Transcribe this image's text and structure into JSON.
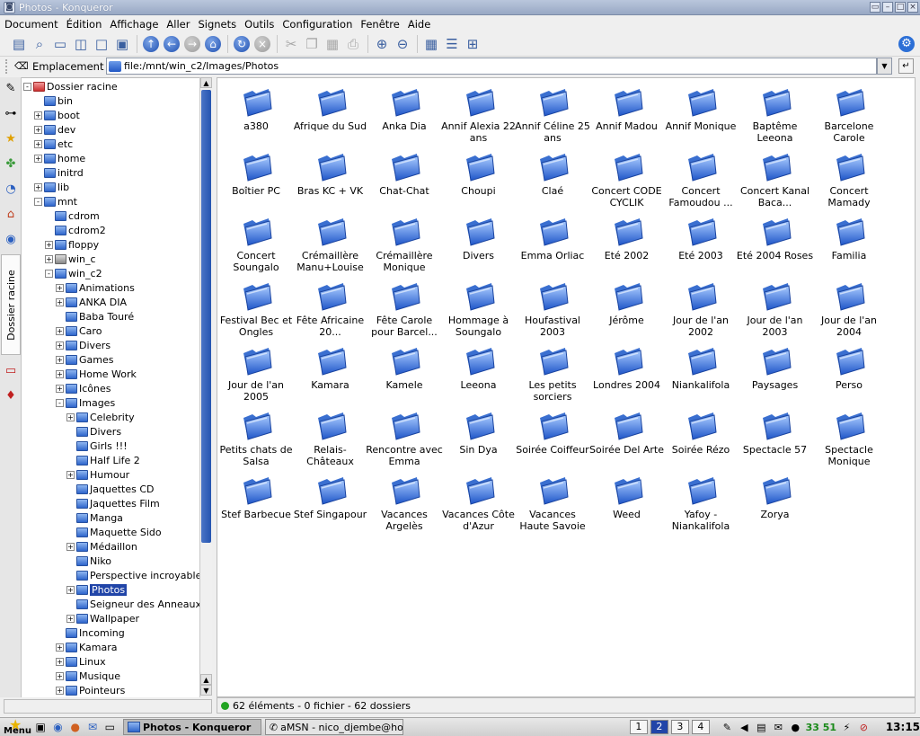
{
  "window": {
    "title": "Photos - Konqueror"
  },
  "menubar": [
    "Document",
    "Édition",
    "Affichage",
    "Aller",
    "Signets",
    "Outils",
    "Configuration",
    "Fenêtre",
    "Aide"
  ],
  "location": {
    "label": "Emplacement :",
    "value": "file:/mnt/win_c2/Images/Photos"
  },
  "sidebar_tab_label": "Dossier racine",
  "tree": [
    {
      "label": "Dossier racine",
      "depth": 0,
      "exp": "-",
      "icon": "red"
    },
    {
      "label": "bin",
      "depth": 1,
      "exp": "",
      "icon": "folder"
    },
    {
      "label": "boot",
      "depth": 1,
      "exp": "+",
      "icon": "folder"
    },
    {
      "label": "dev",
      "depth": 1,
      "exp": "+",
      "icon": "folder"
    },
    {
      "label": "etc",
      "depth": 1,
      "exp": "+",
      "icon": "folder"
    },
    {
      "label": "home",
      "depth": 1,
      "exp": "+",
      "icon": "folder"
    },
    {
      "label": "initrd",
      "depth": 1,
      "exp": "",
      "icon": "folder"
    },
    {
      "label": "lib",
      "depth": 1,
      "exp": "+",
      "icon": "folder"
    },
    {
      "label": "mnt",
      "depth": 1,
      "exp": "-",
      "icon": "folder"
    },
    {
      "label": "cdrom",
      "depth": 2,
      "exp": "",
      "icon": "folder"
    },
    {
      "label": "cdrom2",
      "depth": 2,
      "exp": "",
      "icon": "folder"
    },
    {
      "label": "floppy",
      "depth": 2,
      "exp": "+",
      "icon": "folder"
    },
    {
      "label": "win_c",
      "depth": 2,
      "exp": "+",
      "icon": "drive"
    },
    {
      "label": "win_c2",
      "depth": 2,
      "exp": "-",
      "icon": "folder"
    },
    {
      "label": "Animations",
      "depth": 3,
      "exp": "+",
      "icon": "folder"
    },
    {
      "label": "ANKA DIA",
      "depth": 3,
      "exp": "+",
      "icon": "folder"
    },
    {
      "label": "Baba Touré",
      "depth": 3,
      "exp": "",
      "icon": "folder"
    },
    {
      "label": "Caro",
      "depth": 3,
      "exp": "+",
      "icon": "folder"
    },
    {
      "label": "Divers",
      "depth": 3,
      "exp": "+",
      "icon": "folder"
    },
    {
      "label": "Games",
      "depth": 3,
      "exp": "+",
      "icon": "folder"
    },
    {
      "label": "Home Work",
      "depth": 3,
      "exp": "+",
      "icon": "folder"
    },
    {
      "label": "Icônes",
      "depth": 3,
      "exp": "+",
      "icon": "folder"
    },
    {
      "label": "Images",
      "depth": 3,
      "exp": "-",
      "icon": "folder"
    },
    {
      "label": "Celebrity",
      "depth": 4,
      "exp": "+",
      "icon": "folder"
    },
    {
      "label": "Divers",
      "depth": 4,
      "exp": "",
      "icon": "folder"
    },
    {
      "label": "Girls !!!",
      "depth": 4,
      "exp": "",
      "icon": "folder"
    },
    {
      "label": "Half Life 2",
      "depth": 4,
      "exp": "",
      "icon": "folder"
    },
    {
      "label": "Humour",
      "depth": 4,
      "exp": "+",
      "icon": "folder"
    },
    {
      "label": "Jaquettes CD",
      "depth": 4,
      "exp": "",
      "icon": "folder"
    },
    {
      "label": "Jaquettes Film",
      "depth": 4,
      "exp": "",
      "icon": "folder"
    },
    {
      "label": "Manga",
      "depth": 4,
      "exp": "",
      "icon": "folder"
    },
    {
      "label": "Maquette Sido",
      "depth": 4,
      "exp": "",
      "icon": "folder"
    },
    {
      "label": "Médaillon",
      "depth": 4,
      "exp": "+",
      "icon": "folder"
    },
    {
      "label": "Niko",
      "depth": 4,
      "exp": "",
      "icon": "folder"
    },
    {
      "label": "Perspective incroyable",
      "depth": 4,
      "exp": "",
      "icon": "folder"
    },
    {
      "label": "Photos",
      "depth": 4,
      "exp": "+",
      "icon": "folder",
      "selected": true
    },
    {
      "label": "Seigneur des Anneaux",
      "depth": 4,
      "exp": "",
      "icon": "folder"
    },
    {
      "label": "Wallpaper",
      "depth": 4,
      "exp": "+",
      "icon": "folder"
    },
    {
      "label": "Incoming",
      "depth": 3,
      "exp": "",
      "icon": "folder"
    },
    {
      "label": "Kamara",
      "depth": 3,
      "exp": "+",
      "icon": "folder"
    },
    {
      "label": "Linux",
      "depth": 3,
      "exp": "+",
      "icon": "folder"
    },
    {
      "label": "Musique",
      "depth": 3,
      "exp": "+",
      "icon": "folder"
    },
    {
      "label": "Pointeurs",
      "depth": 3,
      "exp": "+",
      "icon": "folder"
    }
  ],
  "folders": [
    "a380",
    "Afrique du Sud",
    "Anka Dia",
    "Annif Alexia 22 ans",
    "Annif Céline 25 ans",
    "Annif Madou",
    "Annif Monique",
    "Baptême Leeona",
    "Barcelone Carole",
    "Boîtier PC",
    "Bras KC + VK",
    "Chat-Chat",
    "Choupi",
    "Claé",
    "Concert CODE CYCLIK",
    "Concert Famoudou ...",
    "Concert Kanal Baca...",
    "Concert Mamady",
    "Concert Soungalo",
    "Crémaillère Manu+Louise",
    "Crémaillère Monique",
    "Divers",
    "Emma Orliac",
    "Eté 2002",
    "Eté 2003",
    "Eté 2004 Roses",
    "Familia",
    "Festival Bec et Ongles",
    "Fête Africaine 20...",
    "Fête Carole pour Barcel...",
    "Hommage à Soungalo",
    "Houfastival 2003",
    "Jérôme",
    "Jour de l'an 2002",
    "Jour de l'an 2003",
    "Jour de l'an 2004",
    "Jour de l'an 2005",
    "Kamara",
    "Kamele",
    "Leeona",
    "Les petits sorciers",
    "Londres 2004",
    "Niankalifola",
    "Paysages",
    "Perso",
    "Petits chats de Salsa",
    "Relais-Châteaux",
    "Rencontre avec Emma",
    "Sin Dya",
    "Soirée Coiffeur",
    "Soirée Del Arte",
    "Soirée Rézo",
    "Spectacle 57",
    "Spectacle Monique",
    "Stef Barbecue",
    "Stef Singapour",
    "Vacances Argelès",
    "Vacances Côte d'Azur",
    "Vacances Haute Savoie",
    "Weed",
    "Yafoy - Niankalifola",
    "Zorya"
  ],
  "status": "62 éléments - 0 fichier - 62 dossiers",
  "taskbar": {
    "menu_label": "Menu",
    "tasks": [
      "Photos - Konqueror",
      "aMSN - nico_djembe@hotm"
    ],
    "pager": [
      "1",
      "2",
      "3",
      "4"
    ],
    "current_desktop": "2",
    "tray_text": "33 51",
    "clock": "13:15"
  },
  "colors": {
    "selection": "#2145a8",
    "folder_blue": "#2f66cc",
    "titlebar": "#98a8c4"
  }
}
